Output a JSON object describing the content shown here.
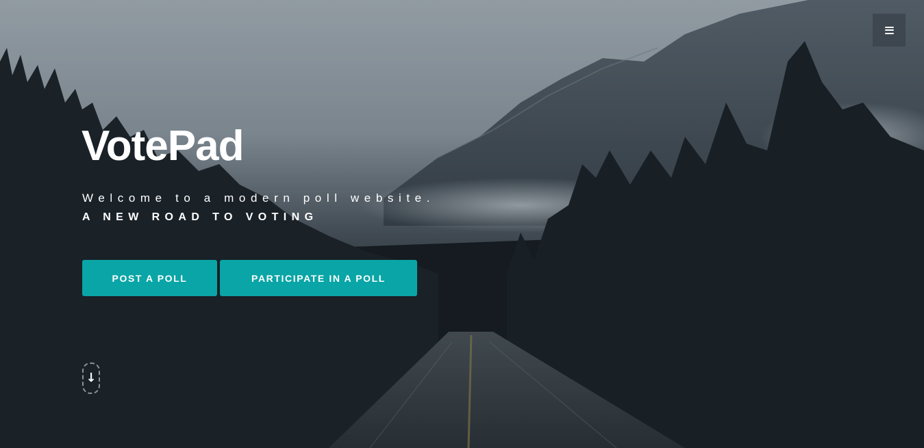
{
  "hero": {
    "title": "VotePad",
    "tagline": "Welcome to a modern poll website.",
    "subtagline": "A NEW ROAD TO VOTING",
    "background_image": "misty-mountain-road-forest"
  },
  "nav": {
    "menu_icon": "hamburger-menu-icon"
  },
  "actions": {
    "post_poll_label": "POST A POLL",
    "participate_label": "PARTICIPATE IN A POLL"
  },
  "scroll": {
    "icon": "arrow-down-icon",
    "glyph": "↓"
  },
  "colors": {
    "accent": "#0aa5a6",
    "text": "#ffffff",
    "overlay_dark": "#151b21"
  }
}
